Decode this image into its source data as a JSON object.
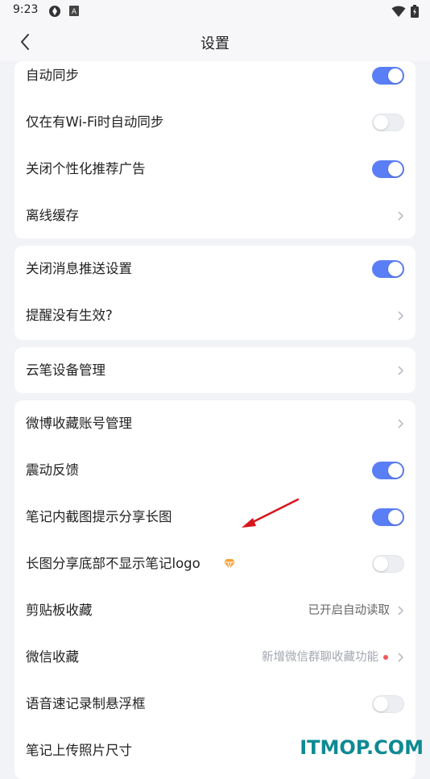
{
  "status_bar": {
    "time": "9:23"
  },
  "header": {
    "title": "设置"
  },
  "sections": [
    {
      "rows": [
        {
          "label": "自动同步",
          "control": "toggle",
          "on": true
        },
        {
          "label": "仅在有Wi-Fi时自动同步",
          "control": "toggle",
          "on": false
        },
        {
          "label": "关闭个性化推荐广告",
          "control": "toggle",
          "on": true
        },
        {
          "label": "离线缓存",
          "control": "chevron"
        }
      ]
    },
    {
      "rows": [
        {
          "label": "关闭消息推送设置",
          "control": "toggle",
          "on": true
        },
        {
          "label": "提醒没有生效?",
          "control": "chevron"
        }
      ]
    },
    {
      "rows": [
        {
          "label": "云笔设备管理",
          "control": "chevron"
        }
      ]
    },
    {
      "rows": [
        {
          "label": "微博收藏账号管理",
          "control": "chevron"
        },
        {
          "label": "震动反馈",
          "control": "toggle",
          "on": true
        },
        {
          "label": "笔记内截图提示分享长图",
          "control": "toggle",
          "on": true
        },
        {
          "label": "长图分享底部不显示笔记logo",
          "control": "toggle",
          "on": false,
          "badge": "vip-diamond-icon"
        },
        {
          "label": "剪贴板收藏",
          "control": "chevron",
          "value": "已开启自动读取"
        },
        {
          "label": "微信收藏",
          "control": "chevron",
          "value": "新增微信群聊收藏功能",
          "dot": true
        },
        {
          "label": "语音速记录制悬浮框",
          "control": "toggle",
          "on": false
        },
        {
          "label": "笔记上传照片尺寸",
          "control": "chevron"
        }
      ]
    }
  ],
  "watermark": "ITMOP.COM",
  "colors": {
    "accent": "#5a7ef5",
    "toggle_off": "#eceef2",
    "dot": "#f05a5a",
    "annotation_arrow": "#d9151b",
    "watermark": "#0e8a93"
  }
}
